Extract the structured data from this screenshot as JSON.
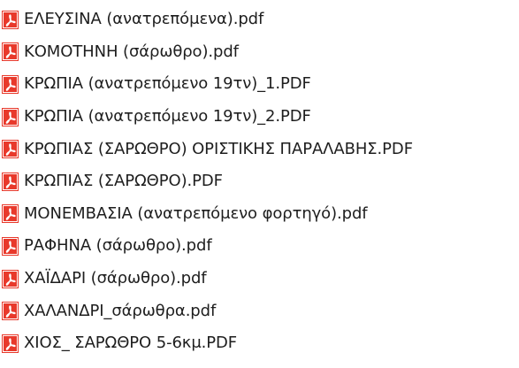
{
  "file_icon": "pdf-file-icon",
  "icon_color": "#e8392b",
  "files": [
    {
      "name": "ΕΛΕΥΣΙΝΑ (ανατρεπόμενα).pdf"
    },
    {
      "name": "ΚΟΜΟΤΗΝΗ (σάρωθρο).pdf"
    },
    {
      "name": "ΚΡΩΠΙΑ (ανατρεπόμενο 19τν)_1.PDF"
    },
    {
      "name": "ΚΡΩΠΙΑ (ανατρεπόμενο 19τν)_2.PDF"
    },
    {
      "name": "ΚΡΩΠΙΑΣ (ΣΑΡΩΘΡΟ) ΟΡΙΣΤΙΚΗΣ ΠΑΡΑΛΑΒΗΣ.PDF"
    },
    {
      "name": "ΚΡΩΠΙΑΣ (ΣΑΡΩΘΡΟ).PDF"
    },
    {
      "name": "ΜΟΝΕΜΒΑΣΙΑ (ανατρεπόμενο φορτηγό).pdf"
    },
    {
      "name": "ΡΑΦΗΝΑ (σάρωθρο).pdf"
    },
    {
      "name": "ΧΑΪΔΑΡΙ (σάρωθρο).pdf"
    },
    {
      "name": "ΧΑΛΑΝΔΡΙ_σάρωθρα.pdf"
    },
    {
      "name": "ΧΙΟΣ_ ΣΑΡΩΘΡΟ 5-6κμ.PDF"
    }
  ]
}
